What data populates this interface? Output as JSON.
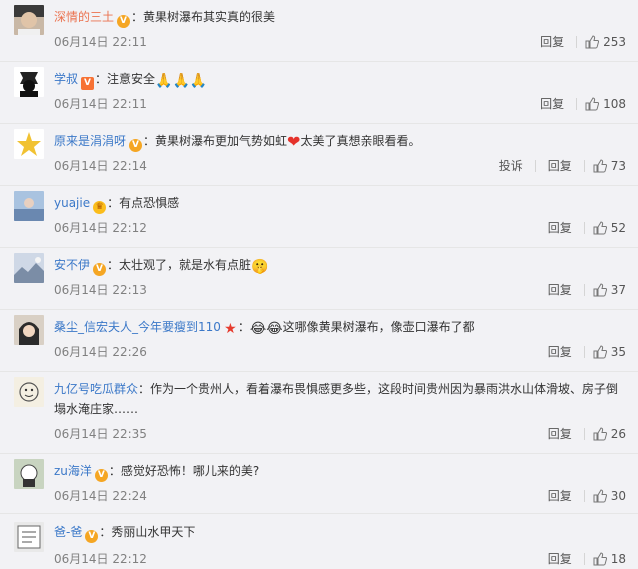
{
  "colors": {
    "username": "#eb7350",
    "link": "#3b78c8",
    "meta": "#808080",
    "heart": "#e5322b",
    "badge_gold": "#f5a623"
  },
  "labels": {
    "reply": "回复",
    "report": "投诉",
    "colon": "："
  },
  "comments": [
    {
      "user": "深情的三土",
      "text": "黄果树瀑布其实真的很美",
      "time": "06月14日 22:11",
      "likes": "253"
    },
    {
      "user": "学叔",
      "text": "注意安全",
      "emoji": "🙏🙏🙏",
      "time": "06月14日 22:11",
      "likes": "108"
    },
    {
      "user": "原来是涓涓呀",
      "text": "黄果树瀑布更加气势如虹",
      "heart": "❤",
      "text2": "太美了真想亲眼看看。",
      "time": "06月14日 22:14",
      "likes": "73"
    },
    {
      "user": "yuajie",
      "text": "有点恐惧感",
      "time": "06月14日 22:12",
      "likes": "52"
    },
    {
      "user": "安不伊",
      "text": "太壮观了，就是水有点脏",
      "emoji": "🤫",
      "time": "06月14日 22:13",
      "likes": "37"
    },
    {
      "user": "桑尘_信宏夫人_今年要瘦到110",
      "emoji": "😂😂",
      "text": "这哪像黄果树瀑布，像壶口瀑布了都",
      "time": "06月14日 22:26",
      "likes": "35"
    },
    {
      "user": "九亿号吃瓜群众",
      "text": "作为一个贵州人，看着瀑布畏惧感更多些，这段时间贵州因为暴雨洪水山体滑坡、房子倒塌水淹庄家……",
      "time": "06月14日 22:35",
      "likes": "26"
    },
    {
      "user": "zu海洋",
      "text": "感觉好恐怖！哪儿来的美?",
      "time": "06月14日 22:24",
      "likes": "30"
    },
    {
      "user": "爸-爸",
      "text": "秀丽山水甲天下",
      "time": "06月14日 22:12",
      "likes": "18"
    }
  ]
}
